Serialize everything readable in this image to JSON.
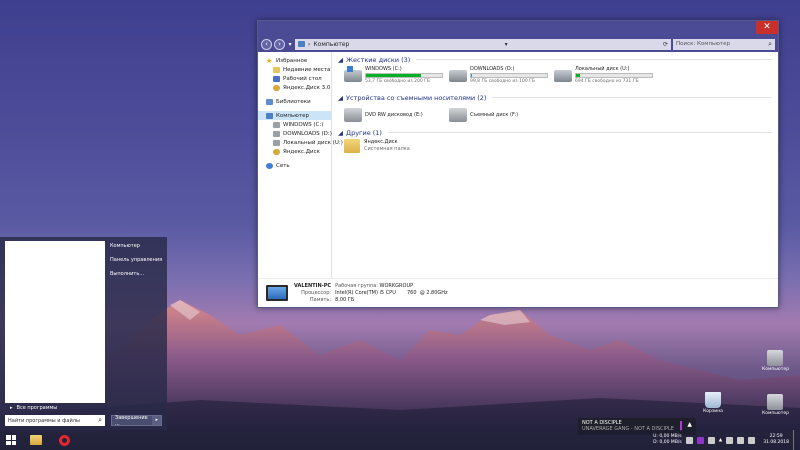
{
  "explorer": {
    "address": "Компьютер",
    "search_placeholder": "Поиск: Компьютер",
    "close": "✕",
    "nav": {
      "favorites": "Избранное",
      "recent": "Недавние места",
      "desktop": "Рабочий стол",
      "yandex_disk": "Яндекс.Диск 3.0",
      "libraries": "Библиотеки",
      "computer": "Компьютер",
      "windows": "WINDOWS (C:)",
      "downloads": "DOWNLOADS (D:)",
      "local": "Локальный диск (U:)",
      "ydisk": "Яндекс.Диск",
      "network": "Сеть"
    },
    "groups": {
      "hdd": "Жесткие диски (3)",
      "removable": "Устройства со съемными носителями (2)",
      "other": "Другие (1)"
    },
    "drives": [
      {
        "name": "WINDOWS (C:)",
        "free": "53,7 ГБ свободно из 200 ГБ",
        "used_fraction": 0.73,
        "color": "#06b025"
      },
      {
        "name": "DOWNLOADS (D:)",
        "free": "99,8 ГБ свободно из 100 ГБ",
        "used_fraction": 0.01,
        "color": "#26a0da"
      },
      {
        "name": "Локальный диск (U:)",
        "free": "694 ГБ свободно из 731 ГБ",
        "used_fraction": 0.05,
        "color": "#06b025"
      }
    ],
    "devices": [
      {
        "name": "DVD RW дисковод (E:)"
      },
      {
        "name": "Съемный диск (F:)"
      }
    ],
    "other_item": {
      "name": "Яндекс.Диск",
      "type": "Системная папка"
    },
    "details": {
      "pc_name": "VALENTIN-PC",
      "workgroup_label": "Рабочая группа:",
      "workgroup": "WORKGROUP",
      "cpu_label": "Процессор:",
      "cpu": "Intel(R) Core(TM) i5 CPU       760  @ 2.80GHz",
      "memory_label": "Память:",
      "memory": "8,00 ГБ"
    }
  },
  "start_menu": {
    "all_programs": "Все программы",
    "search_placeholder": "Найти программы и файлы",
    "right_items": [
      "Компьютер",
      "Панель управления",
      "Выполнить..."
    ],
    "shutdown": "Завершение ..."
  },
  "desktop_icons": [
    {
      "label": "Компьютер"
    },
    {
      "label": "Корзина"
    },
    {
      "label": "Компьютер"
    }
  ],
  "notification": {
    "title": "NOT A DISCIPLE",
    "subtitle": "UNAVERAGE GANG - NOT A DISCIPLE"
  },
  "taskbar": {
    "up_label": "U:",
    "down_label": "D:",
    "up_speed": "0,00 MB/s",
    "down_speed": "0,00 MB/s",
    "time": "22:59",
    "date": "31.08.2018"
  }
}
